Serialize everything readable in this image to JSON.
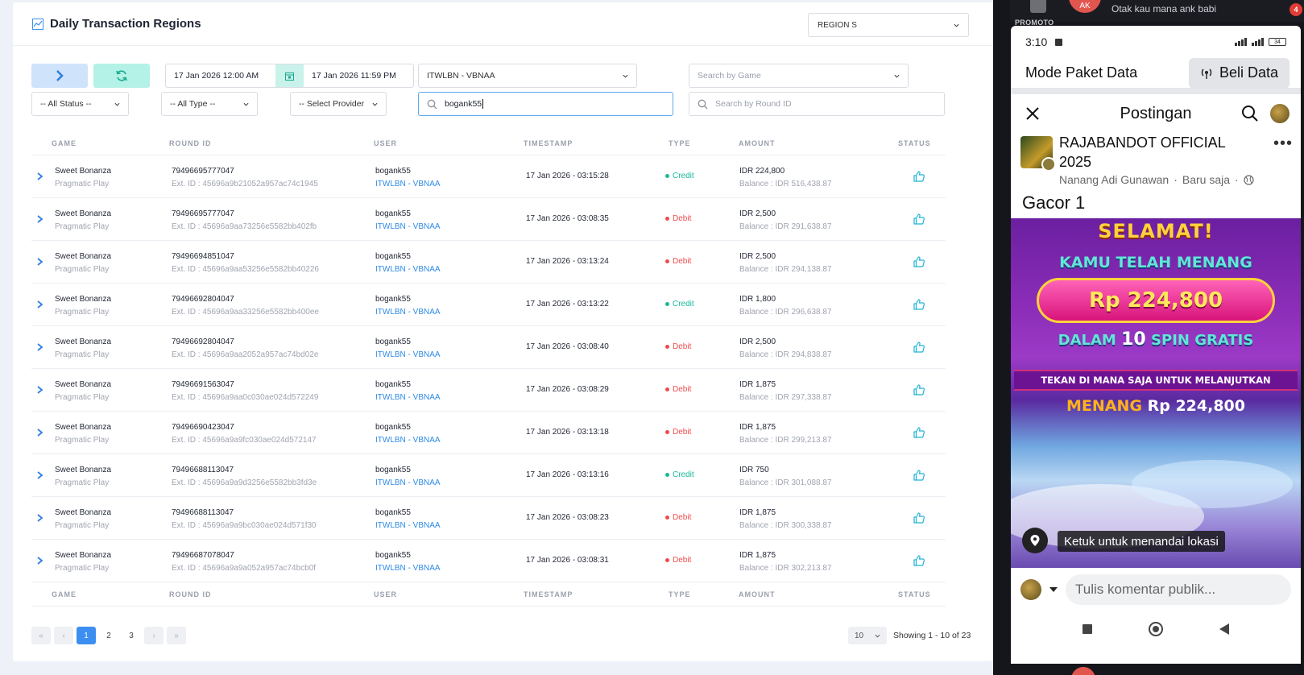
{
  "panel": {
    "title": "Daily Transaction Regions",
    "region_select": "REGION S"
  },
  "filters": {
    "date_from": "17 Jan 2026 12:00 AM",
    "date_to": "17 Jan 2026 11:59 PM",
    "agent_select": "ITWLBN - VBNAA",
    "game_select_placeholder": "Search by Game",
    "status_select": "-- All Status --",
    "type_select": "-- All Type --",
    "provider_select": "-- Select Provider",
    "user_search_value": "bogank55",
    "round_search_placeholder": "Search by Round ID"
  },
  "table": {
    "headers": {
      "game": "GAME",
      "round_id": "ROUND ID",
      "user": "USER",
      "timestamp": "TIMESTAMP",
      "type": "TYPE",
      "amount": "AMOUNT",
      "status": "STATUS"
    },
    "rows": [
      {
        "game": "Sweet Bonanza",
        "provider": "Pragmatic Play",
        "round_id": "79496695777047",
        "ext_id": "Ext. ID : 45696a9b21052a957ac74c1945",
        "user": "bogank55",
        "agent": "ITWLBN - VBNAA",
        "timestamp": "17 Jan 2026 - 03:15:28",
        "type": "Credit",
        "amount": "IDR 224,800",
        "balance": "Balance : IDR 516,438.87"
      },
      {
        "game": "Sweet Bonanza",
        "provider": "Pragmatic Play",
        "round_id": "79496695777047",
        "ext_id": "Ext. ID : 45696a9aa73256e5582bb402fb",
        "user": "bogank55",
        "agent": "ITWLBN - VBNAA",
        "timestamp": "17 Jan 2026 - 03:08:35",
        "type": "Debit",
        "amount": "IDR 2,500",
        "balance": "Balance : IDR 291,638.87"
      },
      {
        "game": "Sweet Bonanza",
        "provider": "Pragmatic Play",
        "round_id": "79496694851047",
        "ext_id": "Ext. ID : 45696a9aa53256e5582bb40226",
        "user": "bogank55",
        "agent": "ITWLBN - VBNAA",
        "timestamp": "17 Jan 2026 - 03:13:24",
        "type": "Debit",
        "amount": "IDR 2,500",
        "balance": "Balance : IDR 294,138.87"
      },
      {
        "game": "Sweet Bonanza",
        "provider": "Pragmatic Play",
        "round_id": "79496692804047",
        "ext_id": "Ext. ID : 45696a9aa33256e5582bb400ee",
        "user": "bogank55",
        "agent": "ITWLBN - VBNAA",
        "timestamp": "17 Jan 2026 - 03:13:22",
        "type": "Credit",
        "amount": "IDR 1,800",
        "balance": "Balance : IDR 296,638.87"
      },
      {
        "game": "Sweet Bonanza",
        "provider": "Pragmatic Play",
        "round_id": "79496692804047",
        "ext_id": "Ext. ID : 45696a9aa2052a957ac74bd02e",
        "user": "bogank55",
        "agent": "ITWLBN - VBNAA",
        "timestamp": "17 Jan 2026 - 03:08:40",
        "type": "Debit",
        "amount": "IDR 2,500",
        "balance": "Balance : IDR 294,838.87"
      },
      {
        "game": "Sweet Bonanza",
        "provider": "Pragmatic Play",
        "round_id": "79496691563047",
        "ext_id": "Ext. ID : 45696a9aa0c030ae024d572249",
        "user": "bogank55",
        "agent": "ITWLBN - VBNAA",
        "timestamp": "17 Jan 2026 - 03:08:29",
        "type": "Debit",
        "amount": "IDR 1,875",
        "balance": "Balance : IDR 297,338.87"
      },
      {
        "game": "Sweet Bonanza",
        "provider": "Pragmatic Play",
        "round_id": "79496690423047",
        "ext_id": "Ext. ID : 45696a9a9fc030ae024d572147",
        "user": "bogank55",
        "agent": "ITWLBN - VBNAA",
        "timestamp": "17 Jan 2026 - 03:13:18",
        "type": "Debit",
        "amount": "IDR 1,875",
        "balance": "Balance : IDR 299,213.87"
      },
      {
        "game": "Sweet Bonanza",
        "provider": "Pragmatic Play",
        "round_id": "79496688113047",
        "ext_id": "Ext. ID : 45696a9a9d3256e5582bb3fd3e",
        "user": "bogank55",
        "agent": "ITWLBN - VBNAA",
        "timestamp": "17 Jan 2026 - 03:13:16",
        "type": "Credit",
        "amount": "IDR 750",
        "balance": "Balance : IDR 301,088.87"
      },
      {
        "game": "Sweet Bonanza",
        "provider": "Pragmatic Play",
        "round_id": "79496688113047",
        "ext_id": "Ext. ID : 45696a9a9bc030ae024d571f30",
        "user": "bogank55",
        "agent": "ITWLBN - VBNAA",
        "timestamp": "17 Jan 2026 - 03:08:23",
        "type": "Debit",
        "amount": "IDR 1,875",
        "balance": "Balance : IDR 300,338.87"
      },
      {
        "game": "Sweet Bonanza",
        "provider": "Pragmatic Play",
        "round_id": "79496687078047",
        "ext_id": "Ext. ID : 45696a9a9a052a957ac74bcb0f",
        "user": "bogank55",
        "agent": "ITWLBN - VBNAA",
        "timestamp": "17 Jan 2026 - 03:08:31",
        "type": "Debit",
        "amount": "IDR 1,875",
        "balance": "Balance : IDR 302,213.87"
      }
    ]
  },
  "pagination": {
    "first": "«",
    "prev": "‹",
    "pages": [
      "1",
      "2",
      "3"
    ],
    "next": "›",
    "last": "»",
    "per_page": "10",
    "showing": "Showing 1 - 10 of 23"
  },
  "colors": {
    "credit": "#19b99a",
    "debit": "#ef4b4b",
    "accent": "#3c8ff0"
  },
  "phone": {
    "notification": {
      "app_label": "PROMOTO",
      "avatar_initials": "AK",
      "text": "Otak kau mana ank babi",
      "badge": "4"
    },
    "status_time": "3:10",
    "battery": "34",
    "mode_title": "Mode Paket Data",
    "beli_button": "Beli Data",
    "post_header": "Postingan",
    "page_name": "RAJABANDOT OFFICIAL 2025",
    "author": "Nanang Adi Gunawan",
    "time": "Baru saja",
    "post_text": "Gacor 1",
    "banner": {
      "selamat": "SELAMAT!",
      "kamu": "KAMU TELAH MENANG",
      "amount": "Rp 224,800",
      "dalam": "DALAM",
      "spins": "10",
      "spin_gratis": "SPIN GRATIS",
      "tekan": "TEKAN DI MANA SAJA UNTUK MELANJUTKAN",
      "menang_label": "MENANG",
      "menang_amount": "Rp 224,800"
    },
    "location_label": "Ketuk untuk menandai lokasi",
    "comment_placeholder": "Tulis komentar publik..."
  }
}
